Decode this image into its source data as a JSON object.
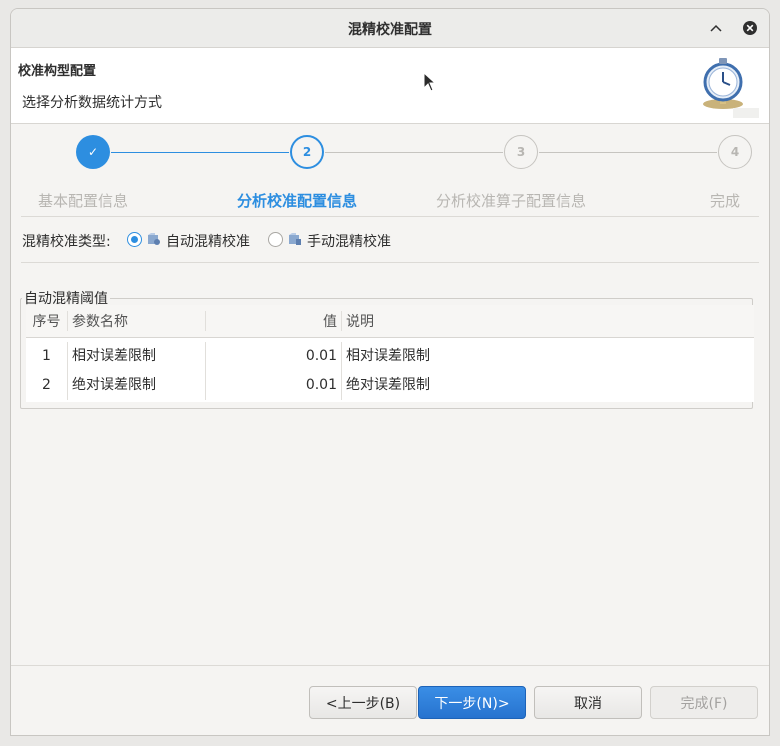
{
  "window": {
    "title": "混精校准配置"
  },
  "header": {
    "title": "校准构型配置",
    "subtitle": "选择分析数据统计方式"
  },
  "steps": [
    {
      "number": "✓",
      "label": "基本配置信息",
      "state": "done"
    },
    {
      "number": "2",
      "label": "分析校准配置信息",
      "state": "active"
    },
    {
      "number": "3",
      "label": "分析校准算子配置信息",
      "state": "pending"
    },
    {
      "number": "4",
      "label": "完成",
      "state": "pending"
    }
  ],
  "calibration_type": {
    "label": "混精校准类型:",
    "options": [
      {
        "label": "自动混精校准",
        "selected": true
      },
      {
        "label": "手动混精校准",
        "selected": false
      }
    ]
  },
  "threshold_group": {
    "title": "自动混精阈值",
    "columns": [
      "序号",
      "参数名称",
      "值",
      "说明"
    ],
    "rows": [
      {
        "index": "1",
        "name": "相对误差限制",
        "value": "0.01",
        "desc": "相对误差限制"
      },
      {
        "index": "2",
        "name": "绝对误差限制",
        "value": "0.01",
        "desc": "绝对误差限制"
      }
    ]
  },
  "footer": {
    "prev": "<上一步(B)",
    "next": "下一步(N)>",
    "cancel": "取消",
    "finish": "完成(F)"
  },
  "colors": {
    "accent": "#2d8ee0",
    "inactive": "#b8b6b2"
  }
}
